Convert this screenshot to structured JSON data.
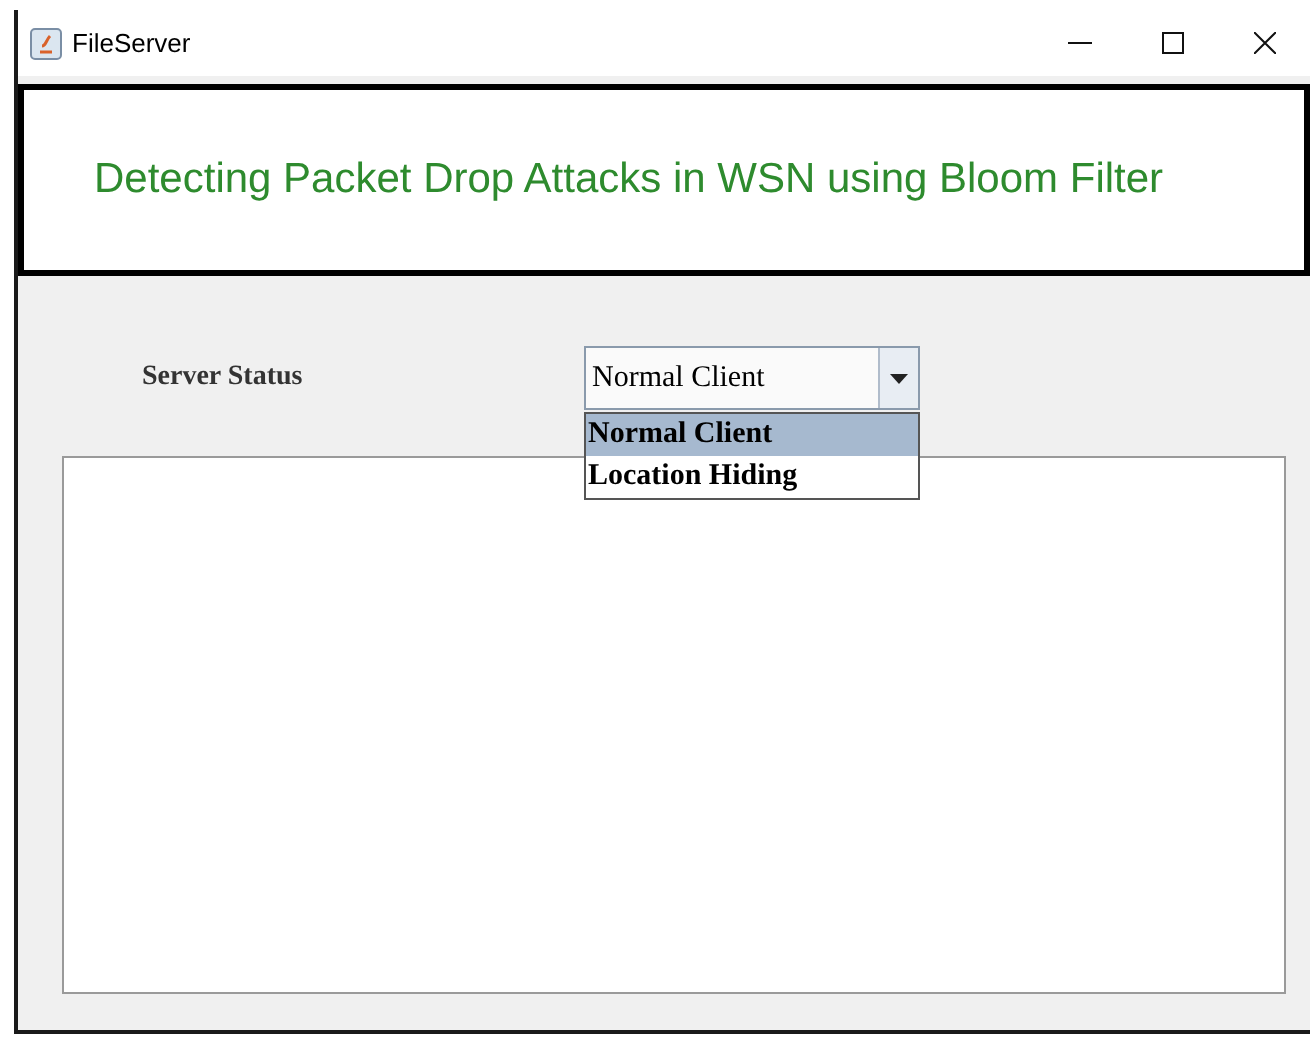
{
  "window": {
    "title": "FileServer"
  },
  "banner": {
    "heading": "Detecting Packet Drop Attacks in WSN using Bloom Filter"
  },
  "status_label": "Server Status",
  "combo": {
    "value": "Normal Client",
    "expanded": true,
    "options": [
      {
        "label": "Normal Client",
        "selected": true
      },
      {
        "label": "Location Hiding",
        "selected": false
      }
    ]
  }
}
